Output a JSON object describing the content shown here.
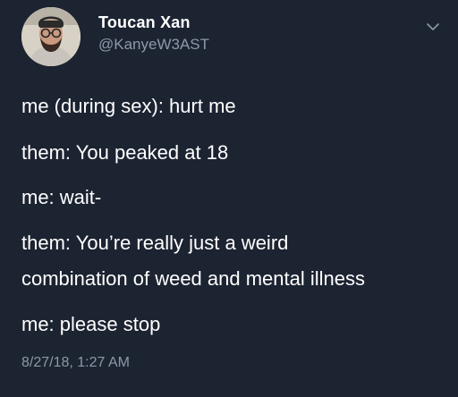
{
  "tweet": {
    "author": {
      "display_name": "Toucan Xan",
      "handle": "@KanyeW3AST"
    },
    "icons": {
      "caret": "chevron-down-icon",
      "avatar": "avatar"
    },
    "lines": [
      "me (during sex): hurt me",
      "them: You peaked at 18",
      "me: wait-",
      "them: You’re really just a weird",
      "combination of weed and mental illness",
      "me: please stop"
    ],
    "timestamp": "8/27/18, 1:27 AM"
  },
  "colors": {
    "background": "#1c2331",
    "text": "#ffffff",
    "muted": "#8d99a8"
  }
}
